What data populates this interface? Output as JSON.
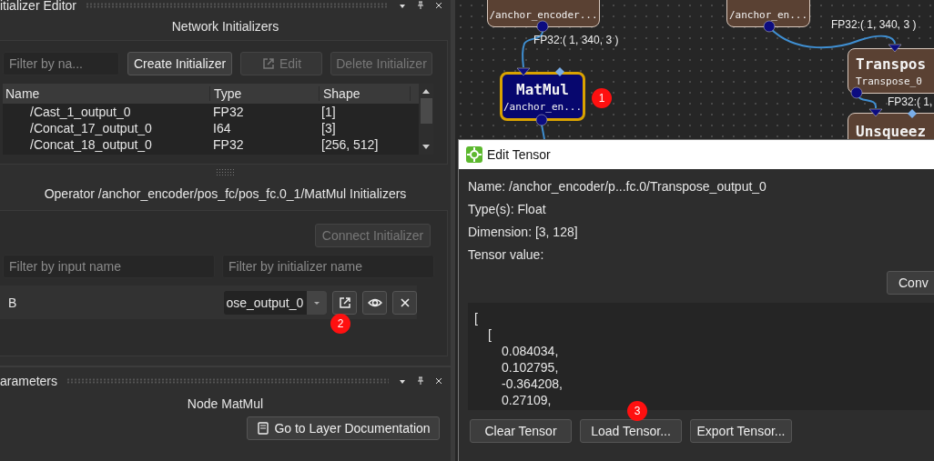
{
  "initializer_editor": {
    "title": "itializer Editor",
    "heading": "Network Initializers",
    "filter": {
      "placeholder": "Filter by na..."
    },
    "buttons": [
      {
        "label": "Create Initializer",
        "disabled": false,
        "icon": false
      },
      {
        "label": "Edit",
        "disabled": true,
        "icon": true
      },
      {
        "label": "Delete Initializer",
        "disabled": true,
        "icon": false
      }
    ],
    "table": {
      "columns": [
        "Name",
        "Type",
        "Shape"
      ],
      "rows": [
        [
          "/Cast_1_output_0",
          "FP32",
          "[1]"
        ],
        [
          "/Concat_17_output_0",
          "I64",
          "[3]"
        ],
        [
          "/Concat_18_output_0",
          "FP32",
          "[256, 512]"
        ]
      ]
    },
    "operator_heading": "Operator /anchor_encoder/pos_fc/pos_fc.0_1/MatMul Initializers",
    "connect_button": {
      "label": "Connect Initializer",
      "disabled": true
    },
    "input_filter": {
      "placeholder": "Filter by input name"
    },
    "initializer_filter": {
      "placeholder": "Filter by initializer name"
    },
    "inputs": [
      {
        "name": "B",
        "value": "ose_output_0"
      }
    ]
  },
  "parameters": {
    "title": "arameters",
    "heading": "Node MatMul",
    "doc_button": "Go to Layer Documentation"
  },
  "graph": {
    "nodes": [
      {
        "kind": "io",
        "label": "/anchor_encoder...",
        "selected": false
      },
      {
        "kind": "io",
        "label": "/anchor_en...",
        "selected": false
      },
      {
        "kind": "op",
        "title": "MatMul",
        "subtitle": "/anchor_en...",
        "selected": true
      },
      {
        "kind": "op",
        "title": "Transpos",
        "subtitle": "Transpose_0",
        "selected": false
      },
      {
        "kind": "op",
        "title": "Unsqueez",
        "selected": false
      }
    ],
    "edge_labels": [
      "FP32:( 1, 340, 3 )",
      "FP32:( 1, 340, 3 )",
      "FP32:( 1,"
    ]
  },
  "dialog": {
    "title": "Edit Tensor",
    "info": [
      "Name: /anchor_encoder/p...fc.0/Transpose_output_0",
      "Type(s): Float",
      "Dimension: [3, 128]",
      "Tensor value:"
    ],
    "convert_button": "Conv",
    "value_lines": [
      {
        "text": "[",
        "children": [
          {
            "text": "[",
            "children": [
              {
                "text": "0.084034,"
              },
              {
                "text": "0.102795,"
              },
              {
                "text": "-0.364208,"
              },
              {
                "text": "0.27109,"
              }
            ]
          }
        ]
      }
    ],
    "buttons": [
      "Clear Tensor",
      "Load Tensor...",
      "Export Tensor..."
    ]
  },
  "callouts": [
    "1",
    "2",
    "3"
  ]
}
